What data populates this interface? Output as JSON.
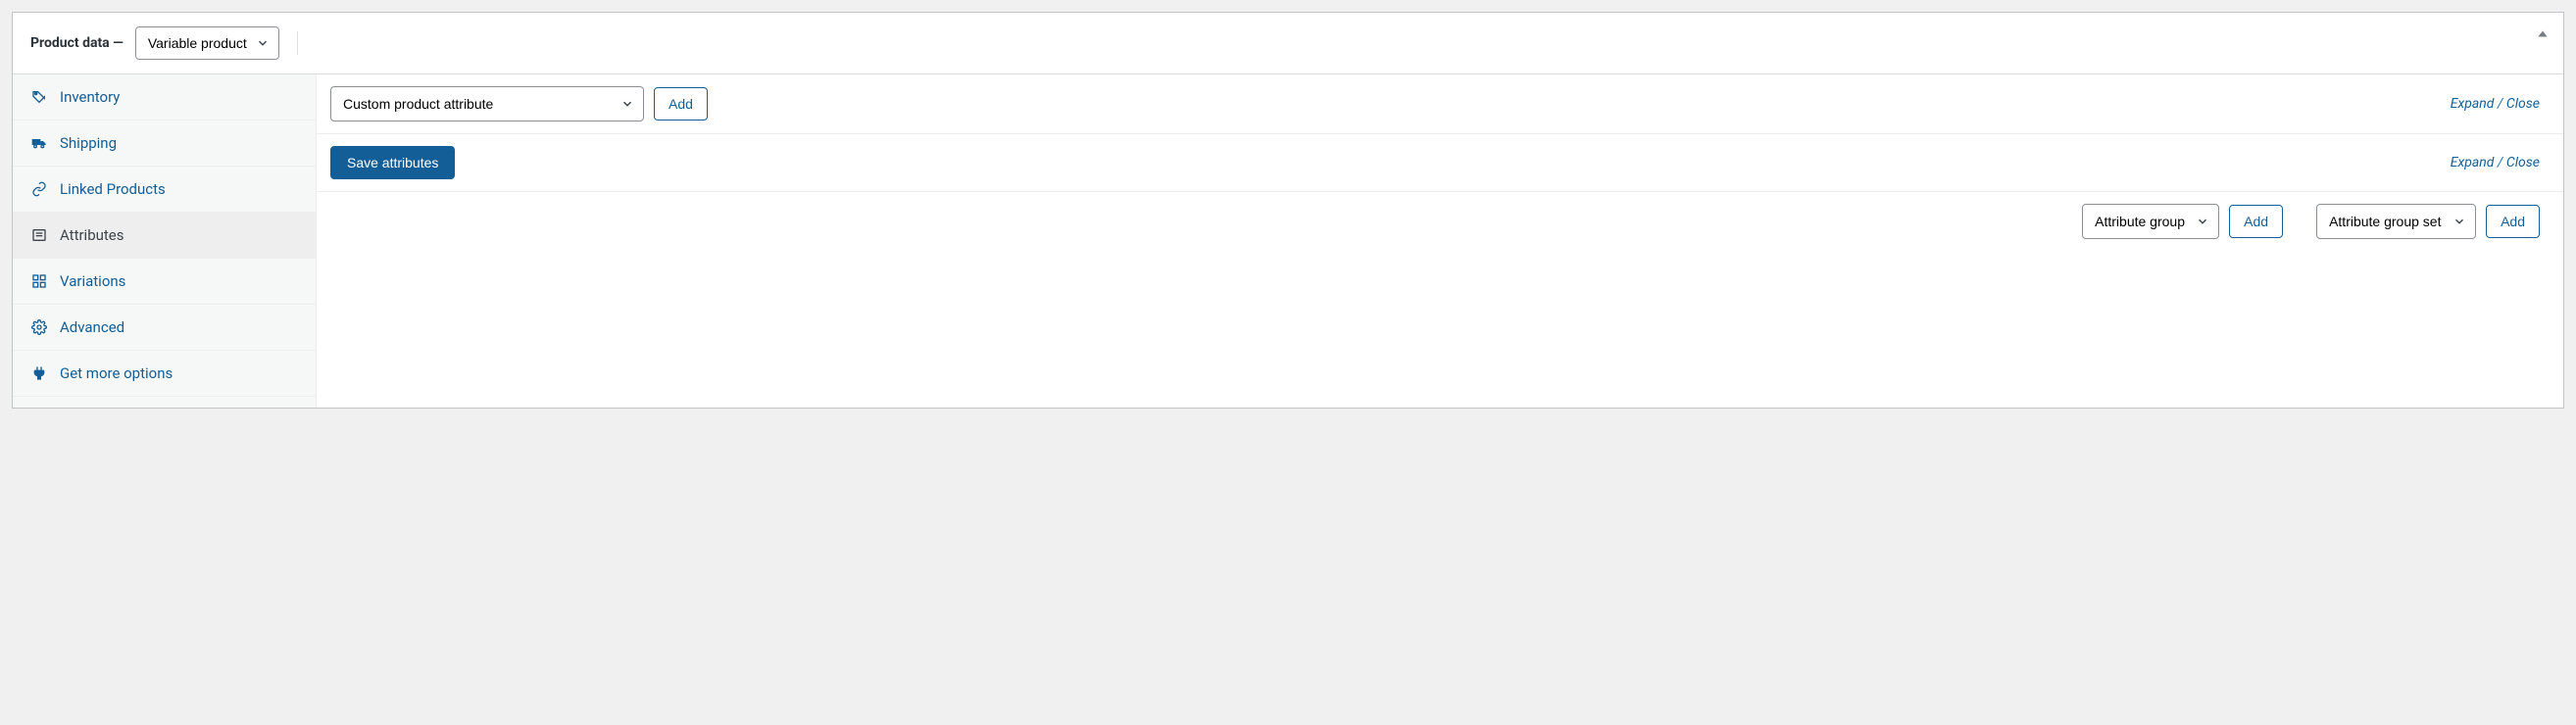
{
  "header": {
    "title_prefix": "Product data",
    "title_sep": " — ",
    "product_type_selected": "Variable product"
  },
  "sidebar": {
    "items": [
      {
        "id": "inventory",
        "label": "Inventory",
        "icon": "tag-icon",
        "active": false
      },
      {
        "id": "shipping",
        "label": "Shipping",
        "icon": "truck-icon",
        "active": false
      },
      {
        "id": "linked",
        "label": "Linked Products",
        "icon": "link-icon",
        "active": false
      },
      {
        "id": "attributes",
        "label": "Attributes",
        "icon": "list-icon",
        "active": true
      },
      {
        "id": "variations",
        "label": "Variations",
        "icon": "grid-icon",
        "active": false
      },
      {
        "id": "advanced",
        "label": "Advanced",
        "icon": "gear-icon",
        "active": false
      },
      {
        "id": "getmore",
        "label": "Get more options",
        "icon": "plug-icon",
        "active": false
      }
    ]
  },
  "content": {
    "attribute_selector_value": "Custom product attribute",
    "add_label": "Add",
    "expand_label": "Expand",
    "close_label": "Close",
    "sep": " / ",
    "save_label": "Save attributes",
    "group_selector_value": "Attribute group",
    "group_set_selector_value": "Attribute group set"
  }
}
